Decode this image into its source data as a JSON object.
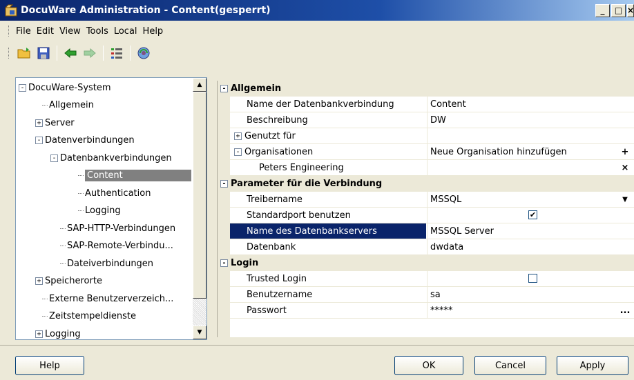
{
  "window": {
    "title": "DocuWare Administration - Content(gesperrt)",
    "minimize": "_",
    "maximize": "□",
    "close": "×"
  },
  "menu": [
    "File",
    "Edit",
    "View",
    "Tools",
    "Local",
    "Help"
  ],
  "toolbar": {
    "icons": [
      "open-folder-icon",
      "save-icon",
      "back-arrow-icon",
      "forward-arrow-icon",
      "properties-icon",
      "refresh-globe-icon"
    ]
  },
  "tree": {
    "items": [
      {
        "label": "DocuWare-System",
        "expander": "-"
      },
      {
        "label": "Allgemein",
        "expander": ""
      },
      {
        "label": "Server",
        "expander": "+"
      },
      {
        "label": "Datenverbindungen",
        "expander": "-"
      },
      {
        "label": "Datenbankverbindungen",
        "expander": "-"
      },
      {
        "label": "Content",
        "expander": "",
        "selected": true
      },
      {
        "label": "Authentication",
        "expander": ""
      },
      {
        "label": "Logging",
        "expander": ""
      },
      {
        "label": "SAP-HTTP-Verbindungen",
        "expander": ""
      },
      {
        "label": "SAP-Remote-Verbindu...",
        "expander": ""
      },
      {
        "label": "Dateiverbindungen",
        "expander": ""
      },
      {
        "label": "Speicherorte",
        "expander": "+"
      },
      {
        "label": "Externe Benutzerverzeich...",
        "expander": ""
      },
      {
        "label": "Zeitstempeldienste",
        "expander": ""
      },
      {
        "label": "Logging",
        "expander": "+"
      }
    ]
  },
  "grid": {
    "rows": [
      {
        "type": "category",
        "label": "Allgemein",
        "expander": "-"
      },
      {
        "type": "prop",
        "name": "Name der Datenbankverbindung",
        "value": "Content"
      },
      {
        "type": "prop",
        "name": "Beschreibung",
        "value": "DW"
      },
      {
        "type": "prop",
        "name": "Genutzt für",
        "value": "",
        "expander": "+"
      },
      {
        "type": "prop",
        "name": "Organisationen",
        "value": "Neue Organisation hinzufügen",
        "expander": "-",
        "icon": "+"
      },
      {
        "type": "prop",
        "name": "Peters Engineering",
        "value": "",
        "sub": true,
        "icon": "×"
      },
      {
        "type": "category",
        "label": "Parameter für die Verbindung",
        "expander": "-"
      },
      {
        "type": "prop",
        "name": "Treibername",
        "value": "MSSQL",
        "icon": "▼"
      },
      {
        "type": "prop",
        "name": "Standardport benutzen",
        "value": "",
        "checkbox": true,
        "checked": true
      },
      {
        "type": "prop",
        "name": "Name des Datenbankservers",
        "value": "MSSQL Server",
        "selected": true
      },
      {
        "type": "prop",
        "name": "Datenbank",
        "value": "dwdata"
      },
      {
        "type": "category",
        "label": "Login",
        "expander": "-"
      },
      {
        "type": "prop",
        "name": "Trusted Login",
        "value": "",
        "checkbox": true,
        "checked": false
      },
      {
        "type": "prop",
        "name": "Benutzername",
        "value": "sa"
      },
      {
        "type": "prop",
        "name": "Passwort",
        "value": "*****",
        "icon": "..."
      }
    ]
  },
  "buttons": {
    "help": "Help",
    "ok": "OK",
    "cancel": "Cancel",
    "apply": "Apply"
  }
}
